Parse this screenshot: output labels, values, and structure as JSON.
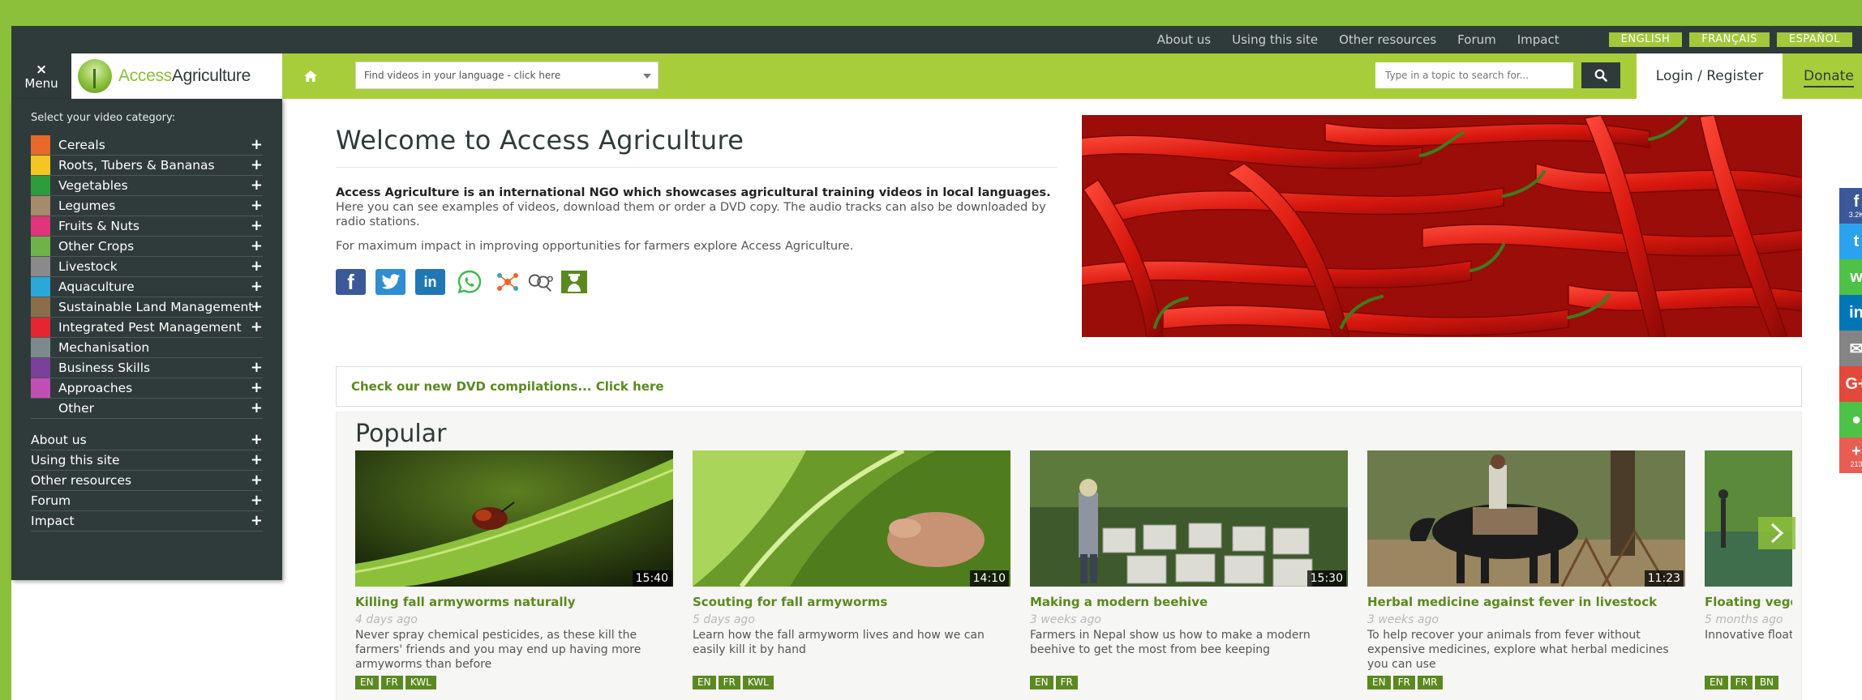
{
  "topbar": {
    "links": [
      "About us",
      "Using this site",
      "Other resources",
      "Forum",
      "Impact"
    ],
    "languages": [
      "ENGLISH",
      "FRANÇAIS",
      "ESPAÑOL"
    ]
  },
  "navbar": {
    "menu_label": "Menu",
    "menu_icon": "×",
    "logo_part1": "Access",
    "logo_part2": "Agriculture",
    "language_select_placeholder": "Find videos in your language - click here",
    "search_placeholder": "Type in a topic to search for...",
    "login_label": "Login / Register",
    "donate_label": "Donate"
  },
  "sidebar": {
    "heading": "Select your video category:",
    "categories": [
      {
        "label": "Cereals",
        "color": "#e8692b",
        "expandable": true
      },
      {
        "label": "Roots, Tubers & Bananas",
        "color": "#f3c623",
        "expandable": true
      },
      {
        "label": "Vegetables",
        "color": "#2d9c3c",
        "expandable": true
      },
      {
        "label": "Legumes",
        "color": "#a58a6b",
        "expandable": true
      },
      {
        "label": "Fruits & Nuts",
        "color": "#e0347b",
        "expandable": true
      },
      {
        "label": "Other Crops",
        "color": "#6fb24a",
        "expandable": true
      },
      {
        "label": "Livestock",
        "color": "#8a8a8a",
        "expandable": true
      },
      {
        "label": "Aquaculture",
        "color": "#2aa8d8",
        "expandable": true
      },
      {
        "label": "Sustainable Land Management",
        "color": "#8b6d4a",
        "expandable": true
      },
      {
        "label": "Integrated Pest Management",
        "color": "#e3262f",
        "expandable": true
      },
      {
        "label": "Mechanisation",
        "color": "#7c8a8e",
        "expandable": false
      },
      {
        "label": "Business Skills",
        "color": "#7b3f9c",
        "expandable": true
      },
      {
        "label": "Approaches",
        "color": "#c04fb5",
        "expandable": true
      },
      {
        "label": "Other",
        "color": "#2f3b3a",
        "expandable": true
      }
    ],
    "links": [
      "About us",
      "Using this site",
      "Other resources",
      "Forum",
      "Impact"
    ]
  },
  "main": {
    "welcome_title": "Welcome to Access Agriculture",
    "intro_bold": "Access Agriculture is an international NGO which showcases agricultural training videos in local languages.",
    "intro_rest": " Here you can see examples of videos, download them or order a DVD copy. The audio tracks can also be downloaded by radio stations.",
    "impact_text": "For maximum impact in improving opportunities for farmers explore Access Agriculture.",
    "social_icons": [
      "facebook-icon",
      "twitter-icon",
      "linkedin-icon",
      "whatsapp-icon",
      "network-icon",
      "link-icon",
      "farmer-icon"
    ],
    "dvd_text": "Check our new DVD compilations... Click here",
    "popular_title": "Popular"
  },
  "videos": [
    {
      "title": "Killing fall armyworms naturally",
      "age": "4 days ago",
      "desc": "Never spray chemical pesticides, as these kill the farmers' friends and you may end up having more armyworms than before",
      "duration": "15:40",
      "tags": [
        "EN",
        "FR",
        "KWL"
      ]
    },
    {
      "title": "Scouting for fall armyworms",
      "age": "5 days ago",
      "desc": "Learn how the fall armyworm lives and how we can easily kill it by hand",
      "duration": "14:10",
      "tags": [
        "EN",
        "FR",
        "KWL"
      ]
    },
    {
      "title": "Making a modern beehive",
      "age": "3 weeks ago",
      "desc": "Farmers in Nepal show us how to make a modern beehive to get the most from bee keeping",
      "duration": "15:30",
      "tags": [
        "EN",
        "FR"
      ]
    },
    {
      "title": "Herbal medicine against fever in livestock",
      "age": "3 weeks ago",
      "desc": "To help recover your animals from fever without expensive medicines, explore what herbal medicines you can use",
      "duration": "11:23",
      "tags": [
        "EN",
        "FR",
        "MR"
      ]
    },
    {
      "title": "Floating vegetable gardens",
      "age": "5 months ago",
      "desc": "Innovative floating garden beds made of compost",
      "duration": "",
      "tags": [
        "EN",
        "FR",
        "BN"
      ]
    }
  ],
  "share_rail": [
    {
      "icon": "facebook-icon",
      "glyph": "f",
      "count": "3.2K",
      "color": "#3b5998"
    },
    {
      "icon": "twitter-icon",
      "glyph": "t",
      "count": "",
      "color": "#2aa3ef"
    },
    {
      "icon": "whatsapp-icon",
      "glyph": "w",
      "count": "",
      "color": "#4dc247"
    },
    {
      "icon": "linkedin-icon",
      "glyph": "in",
      "count": "",
      "color": "#0077b5"
    },
    {
      "icon": "email-icon",
      "glyph": "✉",
      "count": "",
      "color": "#848484"
    },
    {
      "icon": "googleplus-icon",
      "glyph": "G+",
      "count": "",
      "color": "#e3493b"
    },
    {
      "icon": "wechat-icon",
      "glyph": "●",
      "count": "",
      "color": "#4dc247"
    },
    {
      "icon": "more-share-icon",
      "glyph": "+",
      "count": "213",
      "color": "#e85e53"
    }
  ],
  "colors": {
    "brand_green": "#a8cd3a",
    "dark": "#2f3b3a",
    "title_green": "#5a8a1f"
  }
}
